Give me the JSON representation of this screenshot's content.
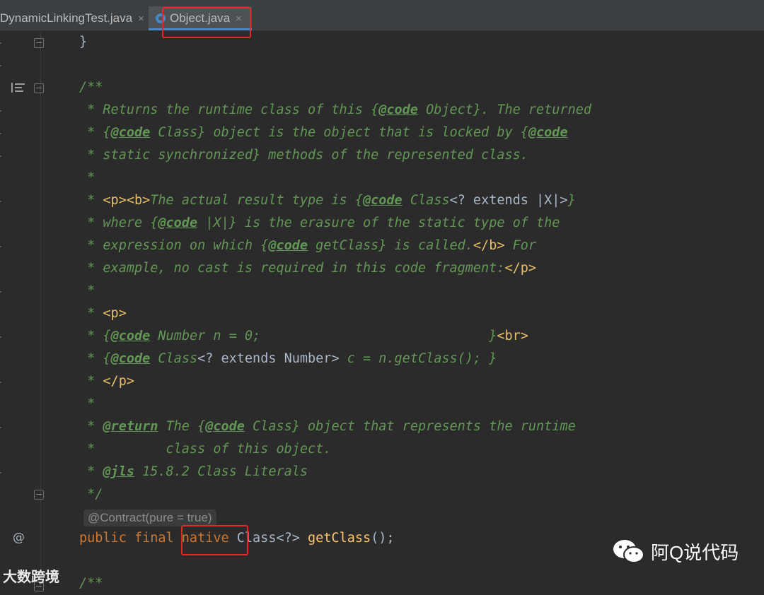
{
  "tabs": [
    {
      "label": "DynamicLinkingTest.java",
      "close": "×",
      "active": false
    },
    {
      "label": "Object.java",
      "close": "×",
      "active": true
    }
  ],
  "code": {
    "l1_brace": "}",
    "l2_open": "/**",
    "l3_a": " * Returns the runtime class of this {",
    "l3_tag": "@code",
    "l3_b": " Object}. The returned",
    "l4_a": " * {",
    "l4_tag": "@code",
    "l4_b": " Class} object is the object that is locked by {",
    "l4_tag2": "@code",
    "l5": " * static synchronized} methods of the represented class.",
    "l6": " *",
    "l7_a": " * ",
    "l7_m1": "<p><b>",
    "l7_b": "The actual result type is {",
    "l7_tag": "@code",
    "l7_c": " Class",
    "l7_r": "<? extends |X|>",
    "l7_d": "}",
    "l8_a": " * where {",
    "l8_tag": "@code",
    "l8_b": " |X|} is the erasure of the static type of the",
    "l9_a": " * expression on which {",
    "l9_tag": "@code",
    "l9_b": " getClass} is called.",
    "l9_m": "</b>",
    "l9_c": " For",
    "l10_a": " * example, no cast is required in this code fragment:",
    "l10_m": "</p>",
    "l11": " *",
    "l12_a": " * ",
    "l12_m": "<p>",
    "l13_a": " * {",
    "l13_tag": "@code",
    "l13_b": " Number n = 0;                             }",
    "l13_m": "<br>",
    "l14_a": " * {",
    "l14_tag": "@code",
    "l14_b": " Class",
    "l14_r": "<? extends Number>",
    "l14_c": " c = n.getClass(); }",
    "l15_a": " * ",
    "l15_m": "</p>",
    "l16": " *",
    "l17_a": " * ",
    "l17_tag": "@return",
    "l17_b": " The {",
    "l17_tag2": "@code",
    "l17_c": " Class} object that represents the runtime",
    "l18": " *         class of this object.",
    "l19_a": " * ",
    "l19_tag": "@jls",
    "l19_b": " 15.8.2 Class Literals",
    "l20": " */",
    "hint": "@Contract(pure = true)",
    "sig_kw": "public final ",
    "sig_native": "native",
    "sig_sp": " ",
    "sig_class": "Class<?> ",
    "sig_fn": "getClass",
    "sig_end": "();",
    "l23": "/**"
  },
  "gutter": {
    "at_marker": "@"
  },
  "watermarks": {
    "left": "大数跨境",
    "right": "阿Q说代码"
  }
}
